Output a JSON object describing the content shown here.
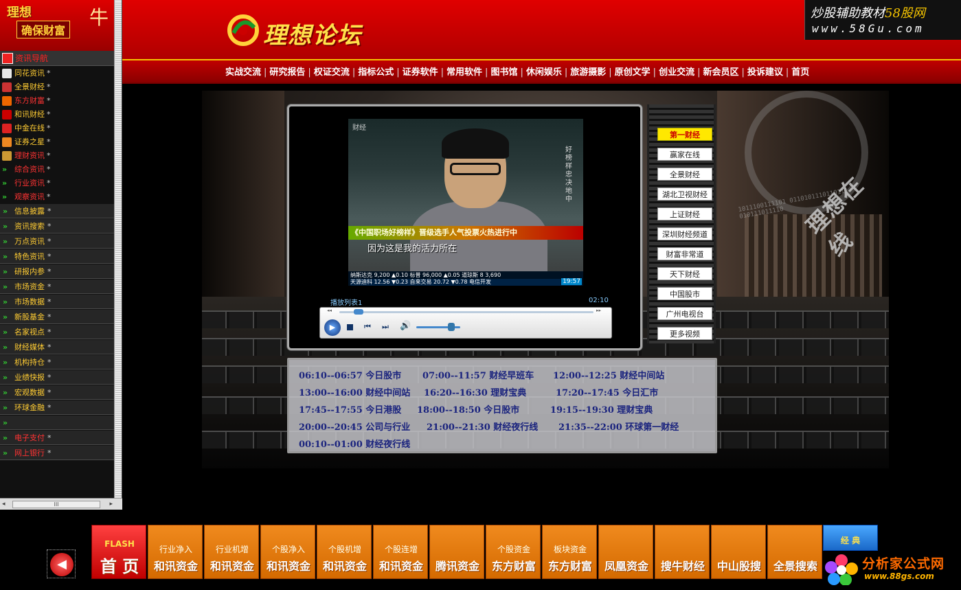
{
  "sidebar": {
    "logo": {
      "line1": "理想",
      "line2": "确保财富",
      "line3": "牛"
    },
    "nav_header": "资讯导航",
    "links": [
      {
        "label": "同花资讯",
        "color": "gold",
        "icon": "flower-icon",
        "icon_color": "#e8e8e8"
      },
      {
        "label": "全景财经",
        "color": "gold",
        "icon": "bars-icon",
        "icon_color": "#c33"
      },
      {
        "label": "东方财富",
        "color": "red",
        "icon": "arrow-mark-icon",
        "icon_color": "#e60"
      },
      {
        "label": "和讯财经",
        "color": "gold",
        "icon": "hexun-icon",
        "icon_color": "#c00"
      },
      {
        "label": "中金在线",
        "color": "gold",
        "icon": "target-icon",
        "icon_color": "#d22"
      },
      {
        "label": "证券之星",
        "color": "gold",
        "icon": "star-icon",
        "icon_color": "#e82"
      },
      {
        "label": "理财资讯",
        "color": "red",
        "icon": "lcicon-icon",
        "icon_color": "#c93"
      },
      {
        "label": "综合资讯",
        "color": "red",
        "icon": "double-arrow-icon",
        "icon_color": ""
      },
      {
        "label": "行业资讯",
        "color": "red",
        "icon": "double-arrow-icon",
        "icon_color": ""
      },
      {
        "label": "观察资讯",
        "color": "red",
        "icon": "double-arrow-icon",
        "icon_color": ""
      }
    ],
    "star": "*",
    "items": [
      {
        "label": "信息披露",
        "color": "gold"
      },
      {
        "label": "资讯搜索",
        "color": "gold"
      },
      {
        "label": "万点资讯",
        "color": "gold"
      },
      {
        "label": "特色资讯",
        "color": "gold"
      },
      {
        "label": "研报内参",
        "color": "gold"
      },
      {
        "label": "市场资金",
        "color": "gold"
      },
      {
        "label": "市场数据",
        "color": "gold"
      },
      {
        "label": "新股基金",
        "color": "gold"
      },
      {
        "label": "名家视点",
        "color": "gold"
      },
      {
        "label": "财经媒体",
        "color": "gold"
      },
      {
        "label": "机构持仓",
        "color": "gold"
      },
      {
        "label": "业绩快报",
        "color": "gold"
      },
      {
        "label": "宏观数据",
        "color": "gold"
      },
      {
        "label": "环球金融",
        "color": "gold"
      },
      {
        "label": "",
        "color": "gold"
      },
      {
        "label": "电子支付",
        "color": "red"
      },
      {
        "label": "网上银行",
        "color": "red"
      }
    ],
    "hscroll_grip": "III"
  },
  "header": {
    "logo_text": "理想论坛",
    "brand_line1_a": "炒股辅助教材",
    "brand_line1_b": "58股网",
    "brand_line2": "www.58Gu.com",
    "nav": [
      "实战交流",
      "研究报告",
      "权证交流",
      "指标公式",
      "证券软件",
      "常用软件",
      "图书馆",
      "休闲娱乐",
      "旅游摄影",
      "原创文学",
      "创业交流",
      "新会员区",
      "投诉建议",
      "首页"
    ],
    "separator": "|"
  },
  "theater": {
    "watermark": "理想在线",
    "binary": "1011100111101 0110101110110111 010111011110"
  },
  "video": {
    "logo": "财经",
    "side_text": "好榜样忠决 地中",
    "banner": "《中国职场好榜样》晋级选手人气投票火热进行中",
    "subtitle": "因为这是我的活力所在",
    "ticker_line1": "纳斯达克 9,200 ▲0.10 标普 96,000 ▲0.05 道琼斯 8 3,690",
    "ticker_line2": "天源迪科 12.56 ▼0.23 自来交易 20.72 ▼0.78 电信开发",
    "clock": "19:57"
  },
  "player": {
    "playlist_label": "播放列表1",
    "time": "02:10",
    "seek_back": "◂◂",
    "seek_fwd": "▸▸",
    "play_glyph": "▶",
    "prev_glyph": "⏮",
    "next_glyph": "⏭",
    "vol_glyph": "🔊",
    "seek_progress": 0.05,
    "volume": 0.8
  },
  "channels": [
    {
      "label": "第一财经",
      "active": true
    },
    {
      "label": "赢家在线",
      "active": false
    },
    {
      "label": "全景财经",
      "active": false
    },
    {
      "label": "湖北卫视财经",
      "active": false
    },
    {
      "label": "上证财经",
      "active": false
    },
    {
      "label": "深圳财经频道",
      "active": false
    },
    {
      "label": "财富非常道",
      "active": false
    },
    {
      "label": "天下财经",
      "active": false
    },
    {
      "label": "中国股市",
      "active": false
    },
    {
      "label": "广州电视台",
      "active": false
    },
    {
      "label": "更多视频",
      "active": false
    }
  ],
  "schedule": [
    [
      "06:10--06:57 今日股市",
      "07:00--11:57 财经早班车",
      "12:00--12:25 财经中间站"
    ],
    [
      "13:00--16:00 财经中间站",
      "16:20--16:30 理财宝典",
      "17:20--17:45 今日汇市"
    ],
    [
      "17:45--17:55 今日港股",
      "18:00--18:50 今日股市",
      "19:15--19:30 理财宝典"
    ],
    [
      "20:00--20:45 公司与行业",
      "21:00--21:30 财经夜行线",
      "21:35--22:00 环球第一财经"
    ],
    [
      "00:10--01:00 财经夜行线"
    ]
  ],
  "bottom": {
    "back_glyph": "◀",
    "home": {
      "top": "FLASH",
      "bottom": "首 页"
    },
    "tiles": [
      {
        "top": "行业净入",
        "bottom": "和讯资金"
      },
      {
        "top": "行业机增",
        "bottom": "和讯资金"
      },
      {
        "top": "个股净入",
        "bottom": "和讯资金"
      },
      {
        "top": "个股机增",
        "bottom": "和讯资金"
      },
      {
        "top": "个股连增",
        "bottom": "和讯资金"
      },
      {
        "top": "",
        "bottom": "腾讯资金"
      },
      {
        "top": "个股资金",
        "bottom": "东方财富"
      },
      {
        "top": "板块资金",
        "bottom": "东方财富"
      },
      {
        "top": "",
        "bottom": "凤凰资金"
      },
      {
        "top": "",
        "bottom": "搜牛财经"
      },
      {
        "top": "",
        "bottom": "中山股搜"
      },
      {
        "top": "",
        "bottom": "全景搜索"
      }
    ],
    "classic": "经 典",
    "fxj_name": "分析家公式网",
    "fxj_url": "www.88gs.com"
  },
  "colors": {
    "brand_red": "#c00000",
    "gold": "#ffd23a",
    "orange_tile": "#f08a1e",
    "schedule_text": "#1a237e"
  }
}
